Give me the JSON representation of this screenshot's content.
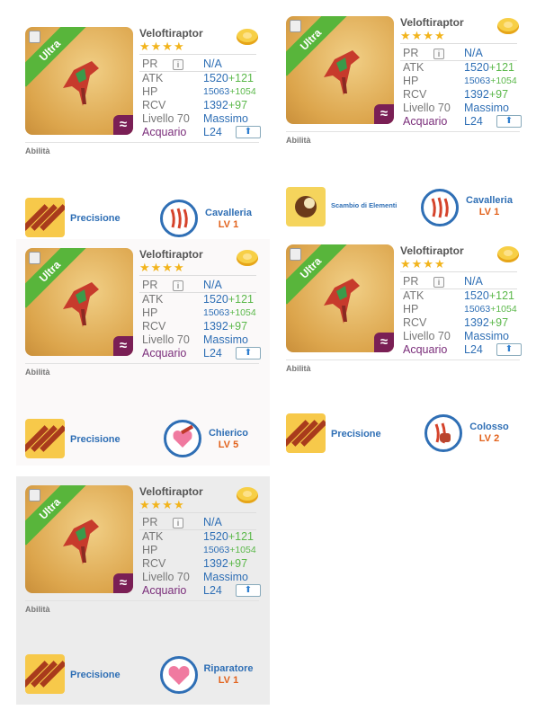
{
  "cards": [
    {
      "name": "Veloftiraptor",
      "stars": "★★★★",
      "ribbon": "Ultra",
      "stats": {
        "pr_label": "PR",
        "pr_value": "N/A",
        "atk_label": "ATK",
        "atk_base": "1520",
        "atk_plus": "+121",
        "hp_label": "HP",
        "hp_base": "15063",
        "hp_plus": "+1054",
        "rcv_label": "RCV",
        "rcv_base": "1392",
        "rcv_plus": "+97",
        "level_label": "Livello 70",
        "level_value": "Massimo",
        "element": "Acquario",
        "element_level": "L24"
      },
      "abilities_label": "Abilità",
      "ability1": {
        "name": "Precisione"
      },
      "ability2": {
        "name": "Cavalleria",
        "level": "LV 1"
      }
    },
    {
      "name": "Veloftiraptor",
      "stars": "★★★★",
      "ribbon": "Ultra",
      "stats": {
        "pr_label": "PR",
        "pr_value": "N/A",
        "atk_label": "ATK",
        "atk_base": "1520",
        "atk_plus": "+121",
        "hp_label": "HP",
        "hp_base": "15063",
        "hp_plus": "+1054",
        "rcv_label": "RCV",
        "rcv_base": "1392",
        "rcv_plus": "+97",
        "level_label": "Livello 70",
        "level_value": "Massimo",
        "element": "Acquario",
        "element_level": "L24"
      },
      "abilities_label": "Abilità",
      "ability1": {
        "name": "Scambio di Elementi"
      },
      "ability2": {
        "name": "Cavalleria",
        "level": "LV 1"
      }
    },
    {
      "name": "Veloftiraptor",
      "stars": "★★★★",
      "ribbon": "Ultra",
      "stats": {
        "pr_label": "PR",
        "pr_value": "N/A",
        "atk_label": "ATK",
        "atk_base": "1520",
        "atk_plus": "+121",
        "hp_label": "HP",
        "hp_base": "15063",
        "hp_plus": "+1054",
        "rcv_label": "RCV",
        "rcv_base": "1392",
        "rcv_plus": "+97",
        "level_label": "Livello 70",
        "level_value": "Massimo",
        "element": "Acquario",
        "element_level": "L24"
      },
      "abilities_label": "Abilità",
      "ability1": {
        "name": "Precisione"
      },
      "ability2": {
        "name": "Chierico",
        "level": "LV 5"
      }
    },
    {
      "name": "Veloftiraptor",
      "stars": "★★★★",
      "ribbon": "Ultra",
      "stats": {
        "pr_label": "PR",
        "pr_value": "N/A",
        "atk_label": "ATK",
        "atk_base": "1520",
        "atk_plus": "+121",
        "hp_label": "HP",
        "hp_base": "15063",
        "hp_plus": "+1054",
        "rcv_label": "RCV",
        "rcv_base": "1392",
        "rcv_plus": "+97",
        "level_label": "Livello 70",
        "level_value": "Massimo",
        "element": "Acquario",
        "element_level": "L24"
      },
      "abilities_label": "Abilità",
      "ability1": {
        "name": "Precisione"
      },
      "ability2": {
        "name": "Colosso",
        "level": "LV 2"
      }
    },
    {
      "name": "Veloftiraptor",
      "stars": "★★★★",
      "ribbon": "Ultra",
      "stats": {
        "pr_label": "PR",
        "pr_value": "N/A",
        "atk_label": "ATK",
        "atk_base": "1520",
        "atk_plus": "+121",
        "hp_label": "HP",
        "hp_base": "15063",
        "hp_plus": "+1054",
        "rcv_label": "RCV",
        "rcv_base": "1392",
        "rcv_plus": "+97",
        "level_label": "Livello 70",
        "level_value": "Massimo",
        "element": "Acquario",
        "element_level": "L24"
      },
      "abilities_label": "Abilità",
      "ability1": {
        "name": "Precisione"
      },
      "ability2": {
        "name": "Riparatore",
        "level": "LV 1"
      }
    }
  ]
}
